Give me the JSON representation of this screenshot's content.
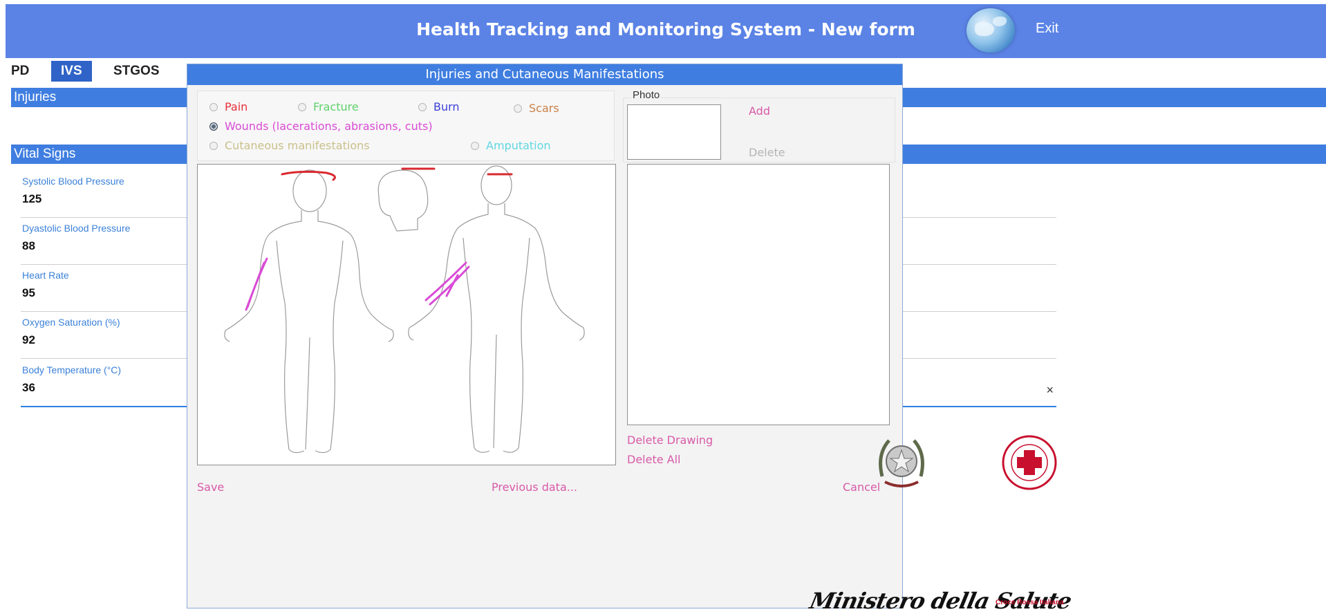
{
  "header": {
    "title": "Health Tracking and Monitoring System - New form",
    "exit_label": "Exit",
    "globe_icon": "globe-icon"
  },
  "tabs": [
    {
      "label": "PD",
      "active": false
    },
    {
      "label": "IVS",
      "active": true
    },
    {
      "label": "STGOS",
      "active": false
    }
  ],
  "sections": {
    "injuries": "Injuries",
    "vital_signs": "Vital Signs"
  },
  "vitals": [
    {
      "label": "Systolic Blood Pressure",
      "value": "125"
    },
    {
      "label": "Dyastolic Blood Pressure",
      "value": "88"
    },
    {
      "label": "Heart Rate",
      "value": "95"
    },
    {
      "label": "Oxygen Saturation (%)",
      "value": "92"
    },
    {
      "label": "Body Temperature (°C)",
      "value": "36"
    }
  ],
  "clear_glyph": "×",
  "modal": {
    "title": "Injuries and Cutaneous Manifestations",
    "categories": {
      "pain": "Pain",
      "fracture": "Fracture",
      "burn": "Burn",
      "scars": "Scars",
      "wounds": "Wounds (lacerations, abrasions, cuts)",
      "cutaneous": "Cutaneous manifestations",
      "amputation": "Amputation"
    },
    "selected_category": "wounds",
    "category_colors": {
      "pain": "#e8303a",
      "fracture": "#5fd16a",
      "burn": "#3b3fd8",
      "scars": "#c98048",
      "wounds": "#d94bd6",
      "cutaneous": "#c9c08a",
      "amputation": "#5fd7e0"
    },
    "photo": {
      "legend": "Photo",
      "add": "Add",
      "delete": "Delete"
    },
    "actions": {
      "delete_drawing": "Delete Drawing",
      "delete_all": "Delete All"
    },
    "footer": {
      "save": "Save",
      "previous": "Previous data...",
      "cancel": "Cancel"
    }
  },
  "logos": {
    "ministry": "Ministero della Salute",
    "cri": "Croce Rossa Italiana"
  },
  "colors": {
    "header_bg": "#5b83e6",
    "section_bg": "#3f7ee0",
    "active_tab": "#2f63c7",
    "link": "#d85aa8"
  }
}
